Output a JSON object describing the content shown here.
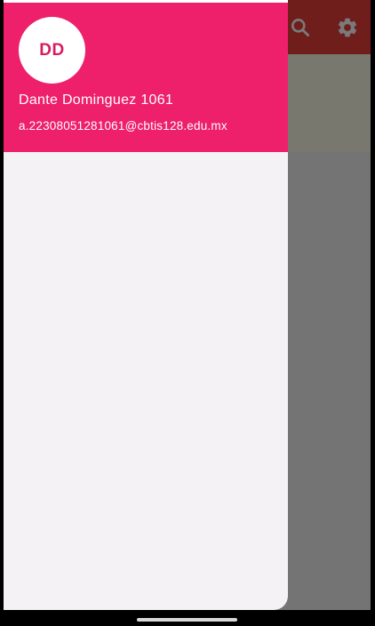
{
  "app_bar": {
    "actions": [
      {
        "icon": "search-icon"
      },
      {
        "icon": "gear-icon"
      }
    ],
    "color": "#e9403b"
  },
  "drawer": {
    "header_color": "#ee1f6b",
    "avatar_initials": "DD",
    "account_name": "Dante Dominguez 1061",
    "account_email": "a.22308051281061@cbtis128.edu.mx"
  }
}
